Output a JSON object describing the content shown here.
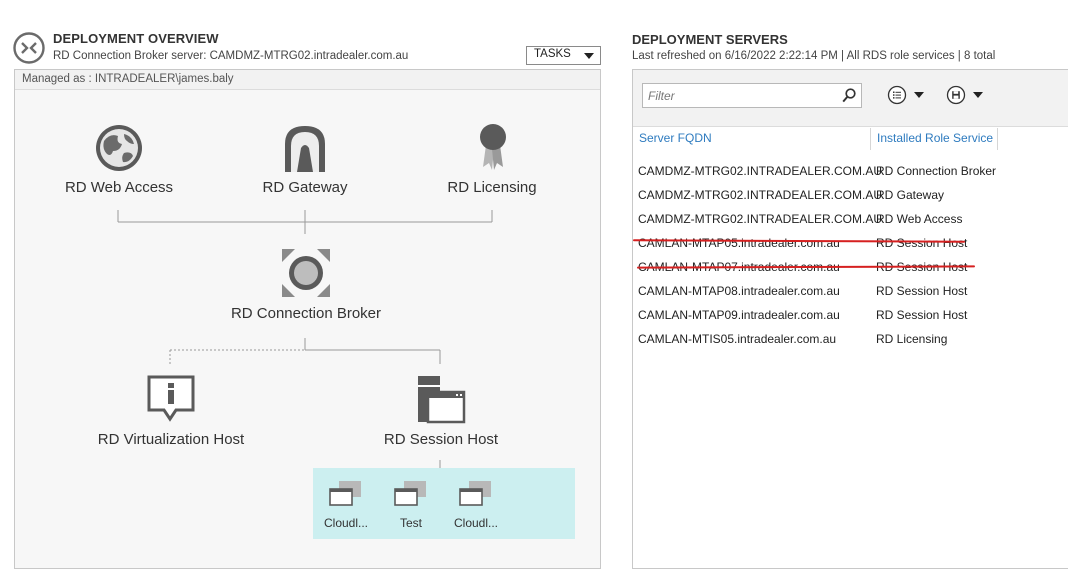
{
  "overview": {
    "title": "DEPLOYMENT OVERVIEW",
    "subtitle": "RD Connection Broker server: CAMDMZ-MTRG02.intradealer.com.au",
    "tasks_label": "TASKS",
    "managed_as": "Managed as : INTRADEALER\\james.baly",
    "nodes": {
      "web_access": "RD Web Access",
      "gateway": "RD Gateway",
      "licensing": "RD Licensing",
      "connection_broker": "RD Connection Broker",
      "virtualization_host": "RD Virtualization Host",
      "session_host": "RD Session Host"
    },
    "collections": [
      {
        "label": "Cloudl...",
        "icon": "collection-icon"
      },
      {
        "label": "Test",
        "icon": "collection-icon"
      },
      {
        "label": "Cloudl...",
        "icon": "collection-icon"
      }
    ]
  },
  "servers": {
    "title": "DEPLOYMENT SERVERS",
    "subtitle": "Last refreshed on 6/16/2022 2:22:14 PM | All RDS role services  | 8 total",
    "filter_placeholder": "Filter",
    "columns": {
      "fqdn": "Server FQDN",
      "role": "Installed Role Service"
    },
    "rows": [
      {
        "fqdn": "CAMDMZ-MTRG02.INTRADEALER.COM.AU",
        "role": "RD Connection Broker",
        "struck": false
      },
      {
        "fqdn": "CAMDMZ-MTRG02.INTRADEALER.COM.AU",
        "role": "RD Gateway",
        "struck": false
      },
      {
        "fqdn": "CAMDMZ-MTRG02.INTRADEALER.COM.AU",
        "role": "RD Web Access",
        "struck": false
      },
      {
        "fqdn": "CAMLAN-MTAP05.intradealer.com.au",
        "role": "RD Session Host",
        "struck": true
      },
      {
        "fqdn": "CAMLAN-MTAP07.intradealer.com.au",
        "role": "RD Session Host",
        "struck": true
      },
      {
        "fqdn": "CAMLAN-MTAP08.intradealer.com.au",
        "role": "RD Session Host",
        "struck": false
      },
      {
        "fqdn": "CAMLAN-MTAP09.intradealer.com.au",
        "role": "RD Session Host",
        "struck": false
      },
      {
        "fqdn": "CAMLAN-MTIS05.intradealer.com.au",
        "role": "RD Licensing",
        "struck": false
      }
    ]
  },
  "colors": {
    "link_blue": "#2e7bbf",
    "strike_red": "#d62020",
    "collection_bg": "#cceff0",
    "icon_gray": "#5a5a5a"
  }
}
